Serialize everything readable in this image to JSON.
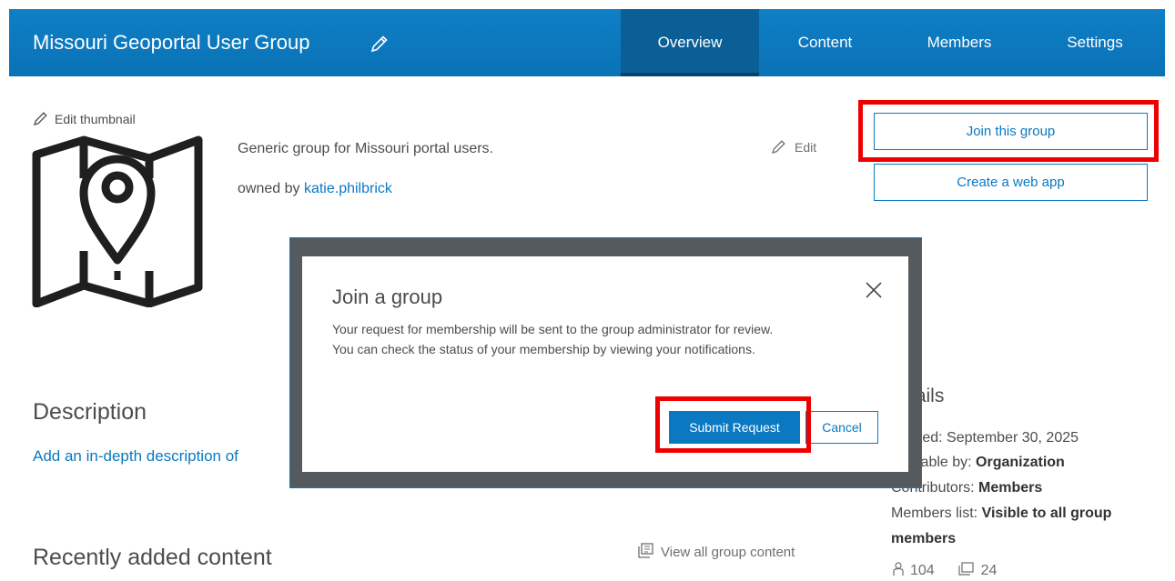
{
  "header": {
    "title": "Missouri Geoportal User Group",
    "tabs": [
      {
        "label": "Overview",
        "active": true
      },
      {
        "label": "Content",
        "active": false
      },
      {
        "label": "Members",
        "active": false
      },
      {
        "label": "Settings",
        "active": false
      }
    ]
  },
  "thumbnail": {
    "edit_label": "Edit thumbnail",
    "icon": "map-pin-icon"
  },
  "summary": {
    "text": "Generic group for Missouri portal users.",
    "owned_prefix": "owned by",
    "owner": "katie.philbrick",
    "edit_label": "Edit"
  },
  "actions": {
    "join": "Join this group",
    "create_app": "Create a web app"
  },
  "description": {
    "heading": "Description",
    "link": "Add an in-depth description of"
  },
  "recent": {
    "heading": "Recently added content",
    "view_all": "View all group content"
  },
  "details": {
    "heading_fragment": "tails",
    "created": "ated: September 30, 2025",
    "viewable_prefix": "wable by:",
    "viewable_value": "Organization",
    "contributors_prefix": "Contributors:",
    "contributors_value": "Members",
    "members_list_prefix": "Members list:",
    "members_list_value": "Visible to all group",
    "members_list_value_2": "members",
    "member_count": "104",
    "item_count": "24"
  },
  "modal": {
    "title": "Join a group",
    "body_line1": "Your request for membership will be sent to the group administrator for review.",
    "body_line2": "You can check the status of your membership by viewing your notifications.",
    "submit": "Submit Request",
    "cancel": "Cancel"
  },
  "colors": {
    "header_bg": "#0b79c1",
    "active_tab": "#0a5f97",
    "accent": "#0a79c1",
    "highlight": "#ee0000",
    "modal_frame": "#555a5e"
  }
}
